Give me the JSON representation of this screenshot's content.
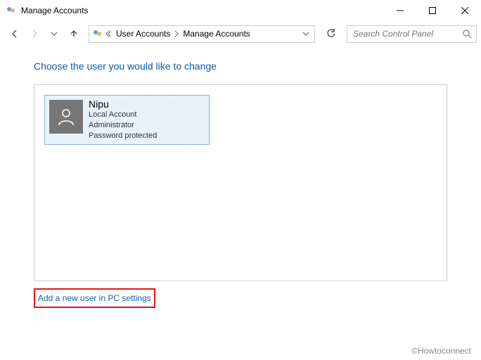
{
  "titlebar": {
    "title": "Manage Accounts"
  },
  "breadcrumb": {
    "items": [
      "User Accounts",
      "Manage Accounts"
    ]
  },
  "search": {
    "placeholder": "Search Control Panel"
  },
  "heading": "Choose the user you would like to change",
  "users": [
    {
      "name": "Nipu",
      "type": "Local Account",
      "role": "Administrator",
      "password": "Password protected"
    }
  ],
  "add_link": "Add a new user in PC settings",
  "watermark": "©Howtoconnect"
}
